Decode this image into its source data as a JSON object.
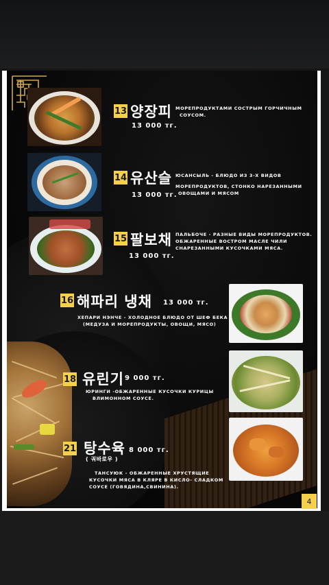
{
  "items": [
    {
      "number": "13",
      "name": "양장피",
      "price": "13 000 тг.",
      "desc": [
        "МОРЕПРОДУКТАМИ СОСТРЫМ ГОРЧИЧНЫМ",
        "СОУСОМ."
      ]
    },
    {
      "number": "14",
      "name": "유산슬",
      "price": "13 000 тг.",
      "desc": [
        "ЮСАНСЫЛЬ - БЛЮДО ИЗ 3-Х ВИДОВ",
        "МОРЕПРОДУКТОВ, СТОНКО НАРЕЗАННЫМИ",
        "ОВОЩАМИ И МЯСОМ"
      ]
    },
    {
      "number": "15",
      "name": "팔보채",
      "price": "13 000 тг.",
      "desc": [
        "ПАЛЬБОЧЕ - РАЗНЫЕ ВИДЫ МОРЕПРОДУКТОВ.",
        "ОБЖАРЕННЫЕ ВОСТРОМ МАСЛЕ ЧИЛИ",
        "СНАРЕЗАННЫМИ КУСОЧКАМИ МЯСА."
      ]
    },
    {
      "number": "16",
      "name": "해파리 냉채",
      "price": "13 000 тг.",
      "desc": [
        "ХЕПАРИ НЭНЧЕ - ХОЛОДНОЕ  БЛЮДО ОТ ШЕФ БЕКА",
        "(МЕДУЗА И МОРЕПРОДУКТЫ, ОВОЩИ, МЯСО)"
      ]
    },
    {
      "number": "18",
      "name": "유린기",
      "price": "9 000 тг.",
      "desc": [
        "ЮРИНГИ -ОБЖАРЕННЫЕ  КУСОЧКИ КУРИЦЫ",
        "ВЛИМОННОМ СОУСЕ."
      ]
    },
    {
      "number": "21",
      "name": "탕수육",
      "subname": "( 궈바로우 )",
      "price": "8 000 тг.",
      "desc": [
        "ТАНСУЮК - ОБЖАРЕННЫЕ ХРУСТЯЩИЕ",
        "КУСОЧКИ МЯСА В КЛЯРЕ В КИСЛО- СЛАДКОМ",
        "СОУСЕ (ГОВЯДИНА,СВИНИНА)."
      ]
    }
  ],
  "page_number": "4",
  "colors": {
    "accent": "#f5d04a",
    "background": "#070707",
    "text": "#ffffff"
  }
}
